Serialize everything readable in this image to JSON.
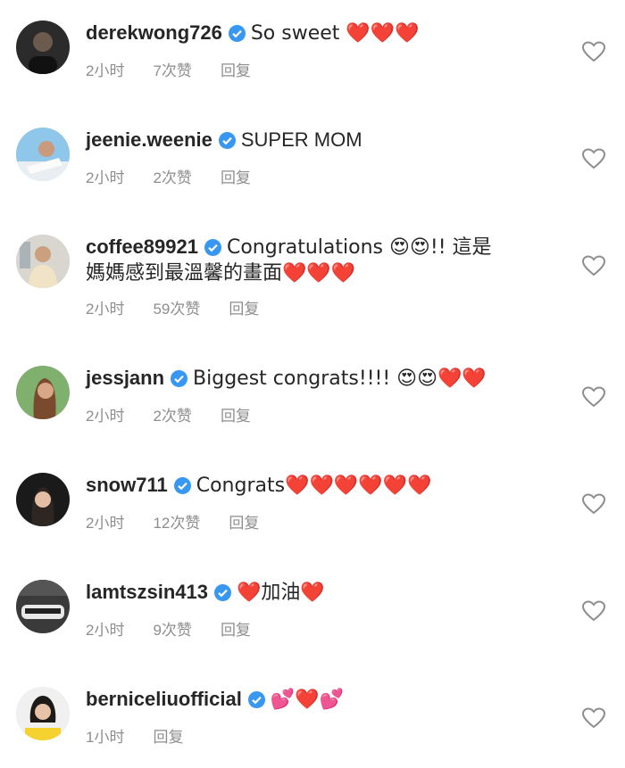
{
  "comments": [
    {
      "username": "derekwong726",
      "text": "So sweet ❤️❤️❤️",
      "time": "2小时",
      "likes": "7次赞",
      "reply": "回复"
    },
    {
      "username": "jeenie.weenie",
      "text": "SUPER MOM",
      "time": "2小时",
      "likes": "2次赞",
      "reply": "回复"
    },
    {
      "username": "coffee89921",
      "text_line1": "Congratulations 😍😍!! 這是",
      "text_line2": "媽媽感到最溫馨的畫面❤️❤️❤️",
      "time": "2小时",
      "likes": "59次赞",
      "reply": "回复"
    },
    {
      "username": "jessjann",
      "text": "Biggest congrats!!!! 😍😍❤️❤️",
      "time": "2小时",
      "likes": "2次赞",
      "reply": "回复"
    },
    {
      "username": "snow711",
      "text": "Congrats❤️❤️❤️❤️❤️❤️",
      "time": "2小时",
      "likes": "12次赞",
      "reply": "回复"
    },
    {
      "username": "lamtszsin413",
      "text": "❤️加油❤️",
      "time": "2小时",
      "likes": "9次赞",
      "reply": "回复"
    },
    {
      "username": "berniceliuofficial",
      "text": "💕❤️💕",
      "time": "1小时",
      "reply": "回复"
    }
  ],
  "icons": {
    "verified": "verified-badge-icon",
    "like": "heart-outline-icon"
  },
  "colors": {
    "verified": "#3897f0",
    "meta": "#8e8e8e",
    "heart": "#e0192f"
  }
}
